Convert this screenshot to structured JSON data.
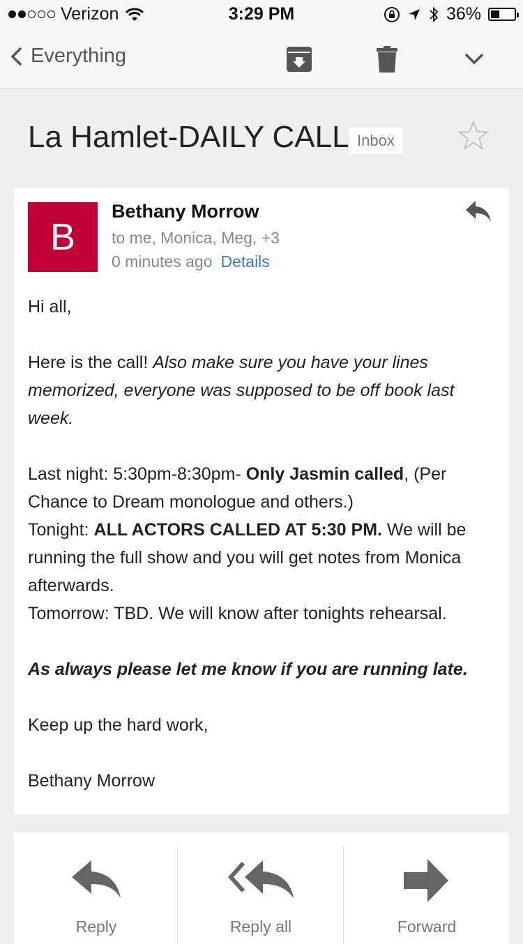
{
  "status_bar": {
    "carrier": "Verizon",
    "time": "3:29 PM",
    "battery_percent": "36%",
    "battery_level": 0.36,
    "signal_bars": 2
  },
  "toolbar": {
    "back_label": "Everything",
    "icons": [
      "archive-icon",
      "trash-icon",
      "chevron-down-icon"
    ]
  },
  "subject": {
    "title": "La Hamlet-DAILY CALL",
    "label": "Inbox"
  },
  "message": {
    "avatar_letter": "B",
    "avatar_color": "#c10036",
    "sender": "Bethany Morrow",
    "recipients": "to me, Monica, Meg, +3",
    "time": "0 minutes ago",
    "details_link": "Details",
    "body": {
      "greeting": "Hi all,",
      "intro": "Here is the call!",
      "intro_italic": "Also make sure you have your lines memorized, everyone was supposed to be off book last week.",
      "last_night_a": "Last night: 5:30pm-8:30pm-",
      "last_night_bold": "Only Jasmin called",
      "last_night_b": ", (Per Chance to Dream monologue and others.)",
      "tonight_a": "Tonight:",
      "tonight_bold": "ALL ACTORS CALLED AT 5:30 PM.",
      "tonight_b": "We will be running the full show and you will get notes from Monica afterwards.",
      "tomorrow": "Tomorrow: TBD. We will know after tonights rehearsal.",
      "reminder": "As always please let me know if you are running late.",
      "closing": "Keep up the hard work,",
      "signature": "Bethany Morrow"
    }
  },
  "actions": [
    {
      "label": "Reply",
      "icon": "reply-icon"
    },
    {
      "label": "Reply all",
      "icon": "reply-all-icon"
    },
    {
      "label": "Forward",
      "icon": "forward-icon"
    }
  ],
  "colors": {
    "accent_link": "#3a78c2",
    "icon_gray": "#666666",
    "background": "#efefef"
  }
}
